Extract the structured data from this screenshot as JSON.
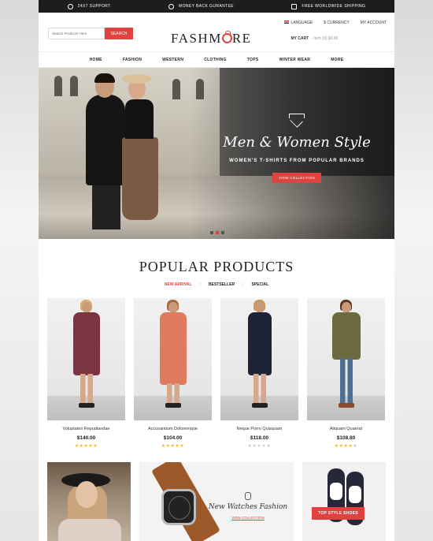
{
  "topbar": {
    "support": "24X7 SUPPORT",
    "guarantee": "MONEY BACK GURANTEE",
    "shipping": "FREE WORLDWIDE SHIPPING"
  },
  "header": {
    "search_placeholder": "Search Products Here",
    "search_button": "SEARCH",
    "logo": "FASHMORE",
    "language": "LANGUAGE",
    "currency": "$ CURRENCY",
    "account": "MY ACCOUNT",
    "cart_label": "MY CART",
    "cart_summary": "- Item (0) $0.00"
  },
  "nav": [
    "HOME",
    "FASHION",
    "WESTERN",
    "CLOTHING",
    "TOPS",
    "WINTER WEAR",
    "MORE"
  ],
  "hero": {
    "title": "Men & Women Style",
    "subtitle": "WOMEN'S T-SHIRTS FROM POPULAR BRANDS",
    "button": "VIEW COLLECTION"
  },
  "section": {
    "title": "POPULAR PRODUCTS",
    "tabs": [
      "NEW ARRIVAL",
      "BESTSELLER",
      "SPECIAL"
    ],
    "tab_separator": "/"
  },
  "products": [
    {
      "name": "Voluptates Repudiandae",
      "price": "$140.00",
      "rating": 5
    },
    {
      "name": "Accusantium Doloremque",
      "price": "$104.00",
      "rating": 5
    },
    {
      "name": "Neque Porro Quisquam",
      "price": "$118.00",
      "rating": 0
    },
    {
      "name": "Aliquam Quaerat",
      "price": "$108.80",
      "rating": 4
    }
  ],
  "banners": {
    "watches_title": "New Watches Fashion",
    "watches_link": "VIEW COLLECTION",
    "shoes_button": "TOP STYLE SHOES"
  },
  "colors": {
    "accent": "#e0433f",
    "topbar": "#1d1d1d",
    "star": "#f3b81a"
  }
}
